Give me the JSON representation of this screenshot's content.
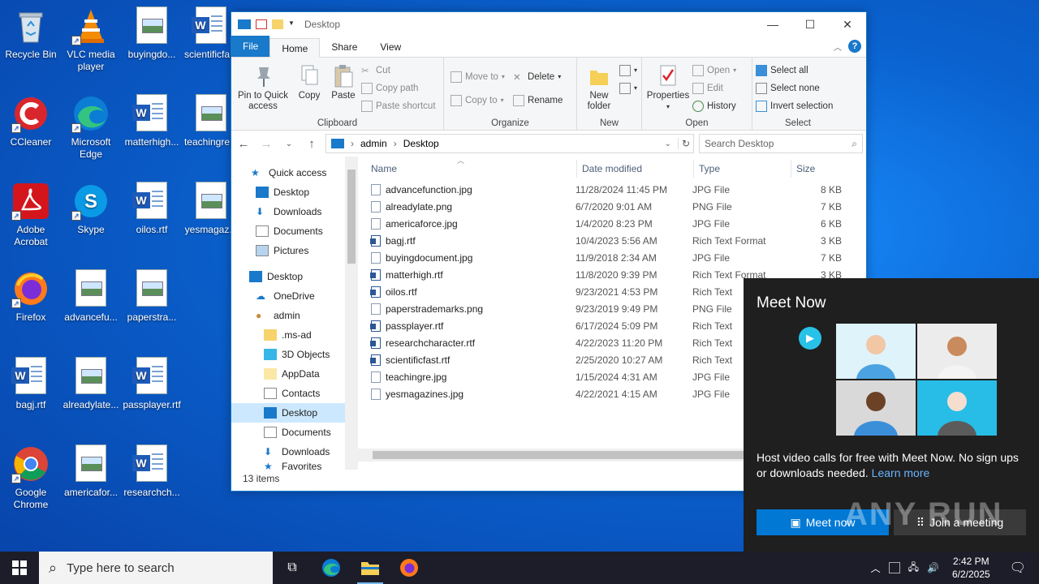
{
  "desktop": {
    "icons": [
      {
        "label": "Recycle Bin"
      },
      {
        "label": "VLC media player"
      },
      {
        "label": "buyingdo..."
      },
      {
        "label": "scientificfa..."
      },
      {
        "label": "CCleaner"
      },
      {
        "label": "Microsoft Edge"
      },
      {
        "label": "matterhigh..."
      },
      {
        "label": "teachingre..."
      },
      {
        "label": "Adobe Acrobat"
      },
      {
        "label": "Skype"
      },
      {
        "label": "oilos.rtf"
      },
      {
        "label": "yesmagaz..."
      },
      {
        "label": "Firefox"
      },
      {
        "label": "advancefu..."
      },
      {
        "label": "paperstra..."
      },
      {
        "label": "bagj.rtf"
      },
      {
        "label": "alreadylate..."
      },
      {
        "label": "passplayer.rtf"
      },
      {
        "label": "Google Chrome"
      },
      {
        "label": "americafor..."
      },
      {
        "label": "researchch..."
      }
    ]
  },
  "explorer": {
    "title": "Desktop",
    "tabs": {
      "file": "File",
      "home": "Home",
      "share": "Share",
      "view": "View"
    },
    "ribbon": {
      "clipboard": {
        "name": "Clipboard",
        "pin": "Pin to Quick access",
        "copy": "Copy",
        "paste": "Paste",
        "cut": "Cut",
        "copy_path": "Copy path",
        "paste_shortcut": "Paste shortcut"
      },
      "organize": {
        "name": "Organize",
        "move_to": "Move to",
        "copy_to": "Copy to",
        "delete": "Delete",
        "rename": "Rename"
      },
      "new": {
        "name": "New",
        "new_folder": "New folder"
      },
      "open": {
        "name": "Open",
        "properties": "Properties",
        "open": "Open",
        "edit": "Edit",
        "history": "History"
      },
      "select": {
        "name": "Select",
        "select_all": "Select all",
        "select_none": "Select none",
        "invert": "Invert selection"
      }
    },
    "address": {
      "crumbs": [
        "admin",
        "Desktop"
      ],
      "search_placeholder": "Search Desktop"
    },
    "nav": [
      {
        "label": "Quick access",
        "pinned": false
      },
      {
        "label": "Desktop",
        "pinned": true
      },
      {
        "label": "Downloads",
        "pinned": true
      },
      {
        "label": "Documents",
        "pinned": true
      },
      {
        "label": "Pictures",
        "pinned": true
      },
      {
        "label": "Desktop",
        "pinned": false
      },
      {
        "label": "OneDrive",
        "pinned": false
      },
      {
        "label": "admin",
        "pinned": false
      },
      {
        "label": ".ms-ad",
        "pinned": false
      },
      {
        "label": "3D Objects",
        "pinned": false
      },
      {
        "label": "AppData",
        "pinned": false
      },
      {
        "label": "Contacts",
        "pinned": false
      },
      {
        "label": "Desktop",
        "pinned": false
      },
      {
        "label": "Documents",
        "pinned": false
      },
      {
        "label": "Downloads",
        "pinned": false
      },
      {
        "label": "Favorites",
        "pinned": false
      }
    ],
    "columns": {
      "name": "Name",
      "date": "Date modified",
      "type": "Type",
      "size": "Size"
    },
    "files": [
      {
        "name": "advancefunction.jpg",
        "date": "11/28/2024 11:45 PM",
        "type": "JPG File",
        "size": "8 KB",
        "kind": "img"
      },
      {
        "name": "alreadylate.png",
        "date": "6/7/2020 9:01 AM",
        "type": "PNG File",
        "size": "7 KB",
        "kind": "img"
      },
      {
        "name": "americaforce.jpg",
        "date": "1/4/2020 8:23 PM",
        "type": "JPG File",
        "size": "6 KB",
        "kind": "img"
      },
      {
        "name": "bagj.rtf",
        "date": "10/4/2023 5:56 AM",
        "type": "Rich Text Format",
        "size": "3 KB",
        "kind": "word"
      },
      {
        "name": "buyingdocument.jpg",
        "date": "11/9/2018 2:34 AM",
        "type": "JPG File",
        "size": "7 KB",
        "kind": "img"
      },
      {
        "name": "matterhigh.rtf",
        "date": "11/8/2020 9:39 PM",
        "type": "Rich Text Format",
        "size": "3 KB",
        "kind": "word"
      },
      {
        "name": "oilos.rtf",
        "date": "9/23/2021 4:53 PM",
        "type": "Rich Text",
        "size": "",
        "kind": "word"
      },
      {
        "name": "paperstrademarks.png",
        "date": "9/23/2019 9:49 PM",
        "type": "PNG File",
        "size": "",
        "kind": "img"
      },
      {
        "name": "passplayer.rtf",
        "date": "6/17/2024 5:09 PM",
        "type": "Rich Text",
        "size": "",
        "kind": "word"
      },
      {
        "name": "researchcharacter.rtf",
        "date": "4/22/2023 11:20 PM",
        "type": "Rich Text",
        "size": "",
        "kind": "word"
      },
      {
        "name": "scientificfast.rtf",
        "date": "2/25/2020 10:27 AM",
        "type": "Rich Text",
        "size": "",
        "kind": "word"
      },
      {
        "name": "teachingre.jpg",
        "date": "1/15/2024 4:31 AM",
        "type": "JPG File",
        "size": "",
        "kind": "img"
      },
      {
        "name": "yesmagazines.jpg",
        "date": "4/22/2021 4:15 AM",
        "type": "JPG File",
        "size": "",
        "kind": "img"
      }
    ],
    "status": "13 items"
  },
  "meetnow": {
    "title": "Meet Now",
    "description": "Host video calls for free with Meet Now. No sign ups or downloads needed.",
    "learn_more": "Learn more",
    "meet_now_button": "Meet now",
    "join_button": "Join a meeting"
  },
  "watermark": "ANY RUN",
  "taskbar": {
    "search_placeholder": "Type here to search",
    "time": "2:42 PM",
    "date": "6/2/2025"
  }
}
